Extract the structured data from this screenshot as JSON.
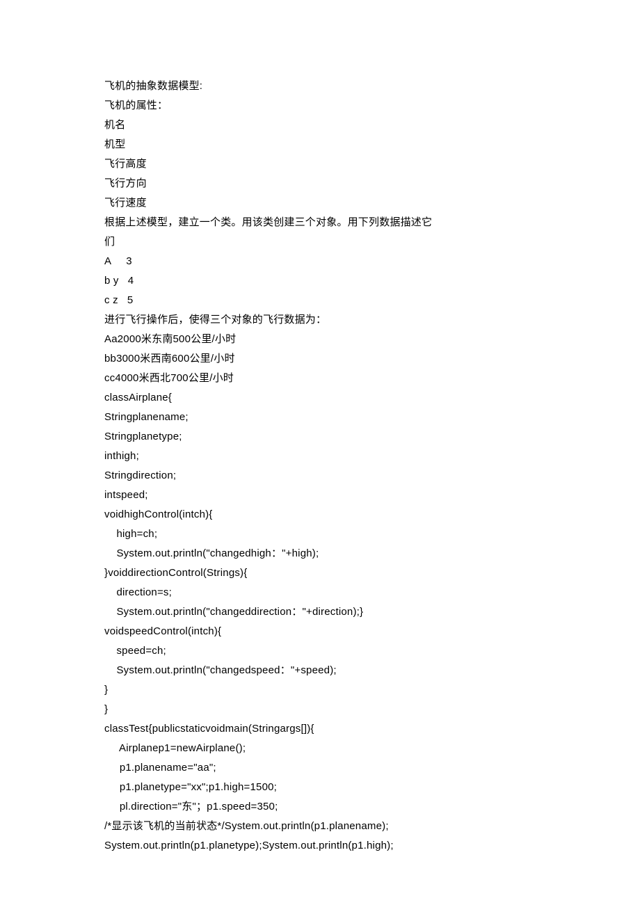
{
  "lines": [
    "飞机的抽象数据模型:",
    "飞机的属性：",
    "机名",
    "机型",
    "飞行高度",
    "飞行方向",
    "飞行速度",
    "根据上述模型，建立一个类。用该类创建三个对象。用下列数据描述它",
    "们",
    "A     3",
    "b y   4",
    "c z   5",
    "进行飞行操作后，使得三个对象的飞行数据为：",
    "Aa2000米东南500公里/小时",
    "bb3000米西南600公里/小时",
    "cc4000米西北700公里/小时",
    "classAirplane{",
    "Stringplanename;",
    "Stringplanetype;",
    "inthigh;",
    "Stringdirection;",
    "intspeed;",
    "voidhighControl(intch){",
    "    high=ch;",
    "    System.out.println(\"changedhigh：\"+high);",
    "}voiddirectionControl(Strings){",
    "    direction=s;",
    "    System.out.println(\"changeddirection：\"+direction);}",
    "voidspeedControl(intch){",
    "    speed=ch;",
    "    System.out.println(\"changedspeed：\"+speed);",
    "}",
    "}",
    "classTest{publicstaticvoidmain(Stringargs[]){",
    "     Airplanep1=newAirplane();",
    "     p1.planename=\"aa\";",
    "     p1.planetype=\"xx\";p1.high=1500;",
    "     pl.direction=\"东\"；p1.speed=350;",
    "/*显示该飞机的当前状态*/System.out.println(p1.planename);",
    "System.out.println(p1.planetype);System.out.println(p1.high);"
  ]
}
